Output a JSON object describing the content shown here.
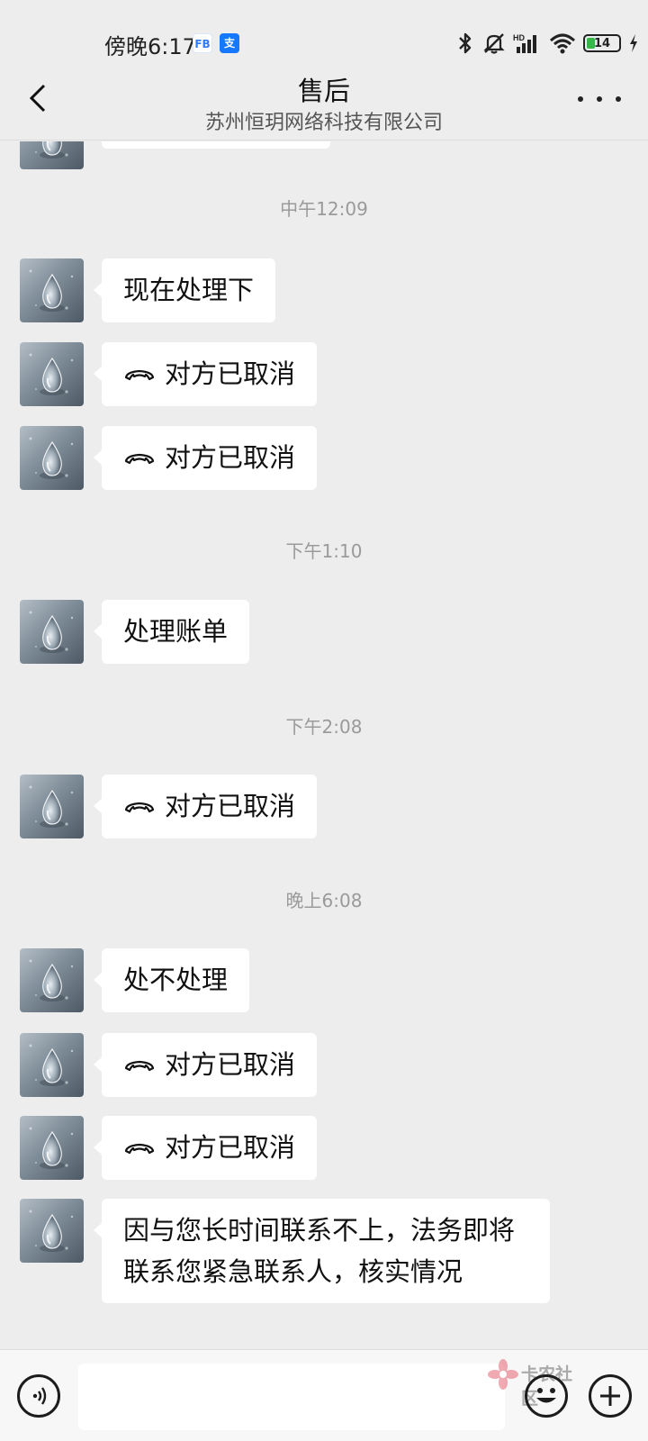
{
  "status_bar": {
    "time": "傍晚6:17",
    "app_badges": [
      "FB",
      "支"
    ],
    "battery_level": "14",
    "icons": [
      "bluetooth-icon",
      "mute-bell-icon",
      "hd-signal-icon",
      "wifi-icon",
      "battery-icon",
      "charging-icon"
    ]
  },
  "header": {
    "title": "售后",
    "subtitle": "苏州恒玥网络科技有限公司"
  },
  "messages": [
    {
      "type": "time",
      "text": "中午12:09"
    },
    {
      "type": "text",
      "text": "现在处理下"
    },
    {
      "type": "call",
      "text": "对方已取消"
    },
    {
      "type": "call",
      "text": "对方已取消"
    },
    {
      "type": "time",
      "text": "下午1:10"
    },
    {
      "type": "text",
      "text": "处理账单"
    },
    {
      "type": "time",
      "text": "下午2:08"
    },
    {
      "type": "call",
      "text": "对方已取消"
    },
    {
      "type": "time",
      "text": "晚上6:08"
    },
    {
      "type": "text",
      "text": "处不处理"
    },
    {
      "type": "call",
      "text": "对方已取消"
    },
    {
      "type": "call",
      "text": "对方已取消"
    },
    {
      "type": "text",
      "text": "因与您长时间联系不上，法务即将联系您紧急联系人，核实情况"
    }
  ],
  "input_bar": {
    "placeholder": "",
    "watermark": "卡农社区"
  },
  "colors": {
    "background": "#ededed",
    "bubble": "#ffffff",
    "battery_fill": "#3bb54a"
  }
}
